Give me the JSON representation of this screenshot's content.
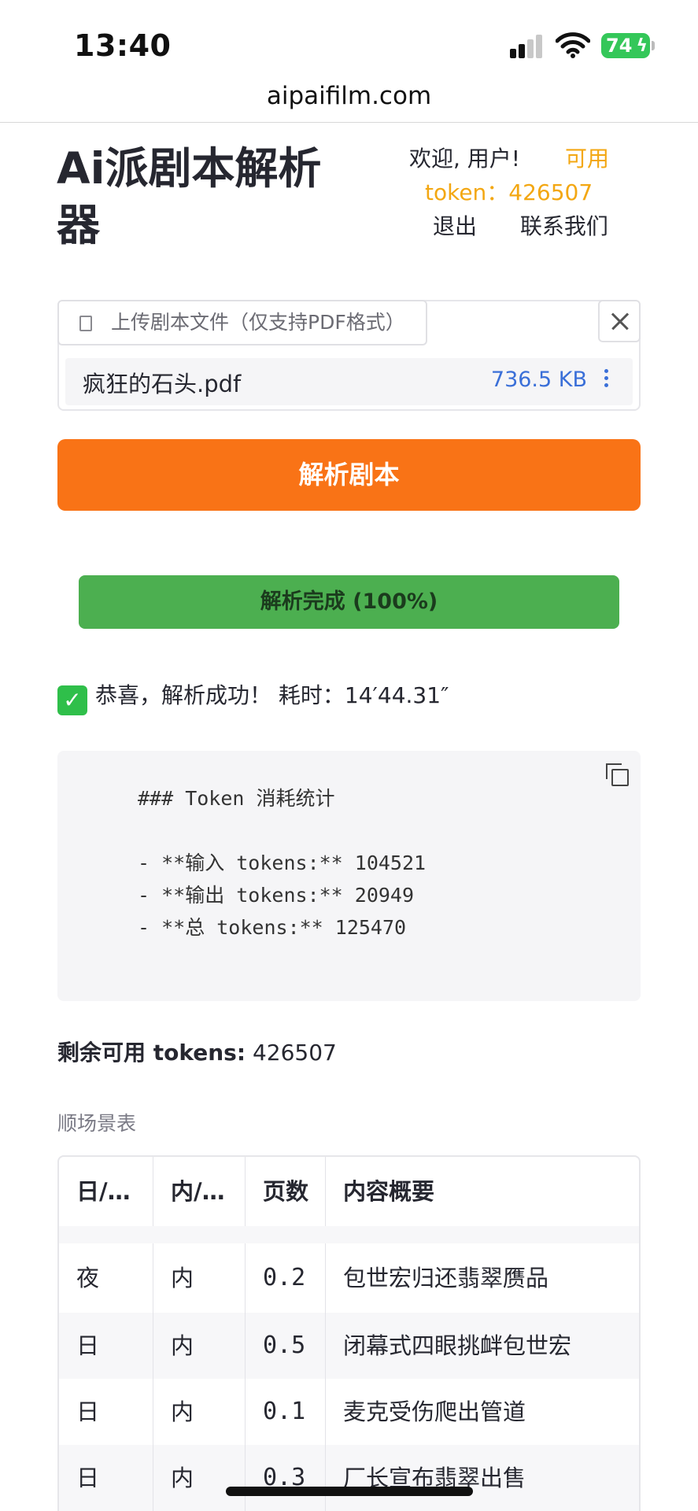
{
  "status_bar": {
    "time": "13:40",
    "battery": "74"
  },
  "browser": {
    "url": "aipaifilm.com"
  },
  "header": {
    "title": "Ai派剧本解析器",
    "welcome": "欢迎, 用户!",
    "available": "可用",
    "token_label": "token：426507",
    "logout": "退出",
    "contact": "联系我们"
  },
  "uploader": {
    "button_label": "上传剧本文件（仅支持PDF格式）",
    "file_name": "疯狂的石头.pdf",
    "file_size": "736.5 KB"
  },
  "parse_button": "解析剧本",
  "progress": {
    "label": "解析完成 (100%)",
    "value": 100
  },
  "success_message": "恭喜，解析成功！ 耗时：14′44.31″",
  "token_stats": {
    "heading": "### Token 消耗统计",
    "input": "- **输入 tokens:** 104521",
    "output": "- **输出 tokens:** 20949",
    "total": "- **总 tokens:** 125470"
  },
  "remaining": {
    "label": "剩余可用 tokens:",
    "value": "426507"
  },
  "table": {
    "caption": "顺场景表",
    "headers": [
      "日/…",
      "内/…",
      "页数",
      "内容概要"
    ],
    "rows": [
      [
        "夜",
        "内",
        "0.2",
        "包世宏归还翡翠赝品"
      ],
      [
        "日",
        "内",
        "0.5",
        "闭幕式四眼挑衅包世宏"
      ],
      [
        "日",
        "内",
        "0.1",
        "麦克受伤爬出管道"
      ],
      [
        "日",
        "内",
        "0.3",
        "厂长宣布翡翠出售"
      ]
    ]
  },
  "colors": {
    "accent": "#f97316",
    "progress": "#4caf50",
    "warning": "#f3a712",
    "link": "#3a6fd8"
  }
}
